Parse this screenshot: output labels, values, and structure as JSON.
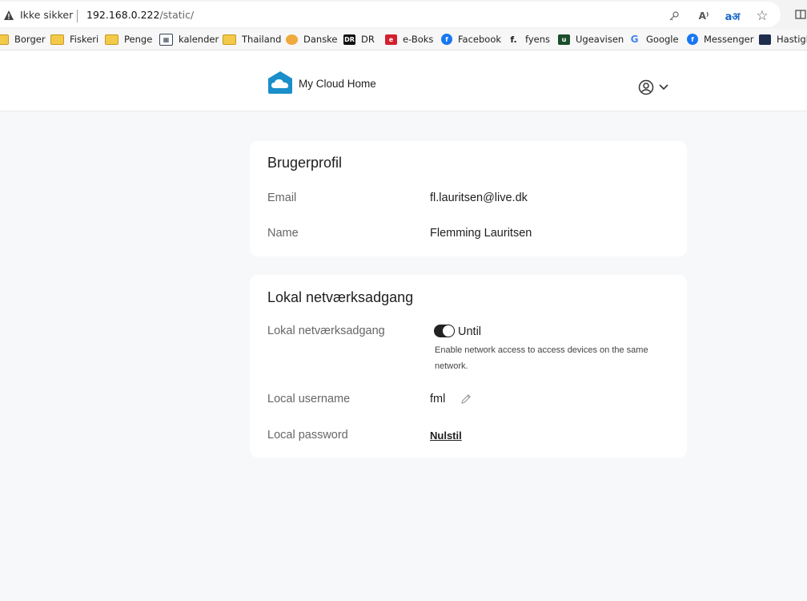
{
  "browser": {
    "security_label": "Ikke sikker",
    "url_host": "192.168.0.222",
    "url_path": "/static/",
    "icons": [
      "warning-icon",
      "key-icon",
      "read-aloud-icon",
      "translate-icon",
      "favorite-star-icon",
      "split-screen-icon"
    ],
    "read_aloud_glyph": "A⁾",
    "translate_glyph": "aअ"
  },
  "bookmarks": [
    {
      "label": "Borger",
      "icon": "folder"
    },
    {
      "label": "Fiskeri",
      "icon": "folder"
    },
    {
      "label": "Penge",
      "icon": "folder"
    },
    {
      "label": "kalender",
      "icon": "calendar"
    },
    {
      "label": "Thailand",
      "icon": "folder"
    },
    {
      "label": "Danske",
      "icon": "danske"
    },
    {
      "label": "DR",
      "icon": "dr"
    },
    {
      "label": "e-Boks",
      "icon": "eboks"
    },
    {
      "label": "Facebook",
      "icon": "facebook"
    },
    {
      "label": "fyens",
      "icon": "fyens"
    },
    {
      "label": "Ugeavisen",
      "icon": "ugeavisen"
    },
    {
      "label": "Google",
      "icon": "google"
    },
    {
      "label": "Messenger",
      "icon": "facebook"
    },
    {
      "label": "Hastigh",
      "icon": "speed"
    }
  ],
  "app": {
    "logo_text": "My Cloud Home",
    "brand_color": "#1a8fc9"
  },
  "profile": {
    "title": "Brugerprofil",
    "email_label": "Email",
    "email_value": "fl.lauritsen@live.dk",
    "name_label": "Name",
    "name_value": "Flemming Lauritsen"
  },
  "network": {
    "title": "Lokal netværksadgang",
    "access_label": "Lokal netværksadgang",
    "toggle_state": "on",
    "toggle_label": "Until",
    "help_text": "Enable network access to access devices on the same network.",
    "username_label": "Local username",
    "username_value": "fml",
    "password_label": "Local password",
    "password_action": "Nulstil"
  }
}
